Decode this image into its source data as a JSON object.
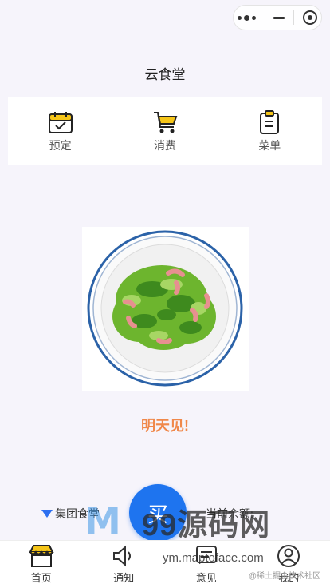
{
  "header": {
    "title": "云食堂"
  },
  "quick_actions": [
    {
      "label": "预定",
      "icon": "calendar-check-icon"
    },
    {
      "label": "消费",
      "icon": "cart-icon"
    },
    {
      "label": "菜单",
      "icon": "clipboard-icon"
    }
  ],
  "main": {
    "message": "明天见!",
    "canteen_selector": "集团食堂",
    "balance_label": "当前余额:",
    "buy_label": "买"
  },
  "tabbar": [
    {
      "label": "首页",
      "icon": "shop-icon",
      "active": true
    },
    {
      "label": "通知",
      "icon": "speaker-icon",
      "active": false
    },
    {
      "label": "意见",
      "icon": "feedback-icon",
      "active": false
    },
    {
      "label": "我的",
      "icon": "profile-icon",
      "active": false
    }
  ],
  "watermark": {
    "brand": "99源码网",
    "url": "ym.maptoface.com",
    "credit": "@稀土掘金技术社区"
  },
  "colors": {
    "accent": "#1e74ef",
    "highlight": "#f0884a",
    "icon_yellow": "#f5c518"
  }
}
